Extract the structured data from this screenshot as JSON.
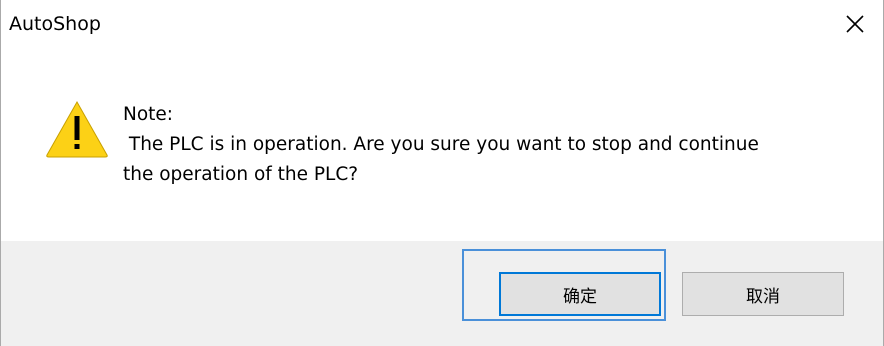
{
  "window": {
    "title": "AutoShop"
  },
  "message": {
    "heading": "Note:",
    "line1": " The PLC is in operation. Are you sure you want to stop and continue",
    "line2": "the operation of the PLC?"
  },
  "buttons": {
    "ok_label": "确定",
    "cancel_label": "取消"
  },
  "icons": {
    "close": "close-icon",
    "warning": "warning-icon"
  },
  "colors": {
    "footer_background": "#f0f0f0",
    "focus_accent": "#0078d7",
    "warning_fill": "#fcd116"
  }
}
